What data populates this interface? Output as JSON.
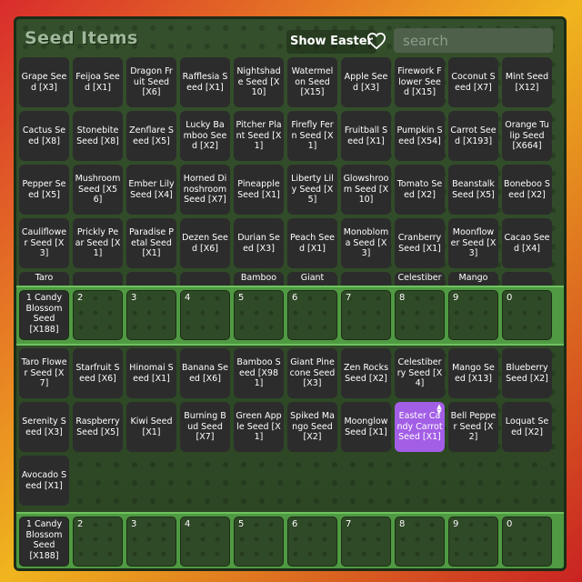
{
  "header": {
    "title": "Seed Items",
    "show_easter_label": "Show Easter",
    "search_placeholder": "search"
  },
  "top_grid": [
    [
      "Grape Seed [X3]",
      "Feijoa Seed [X1]",
      "Dragon Fruit Seed [X6]",
      "Rafflesia Seed [X1]",
      "Nightshade Seed [X10]",
      "Watermelon Seed [X15]",
      "Apple Seed [X3]",
      "Firework Flower Seed [X15]",
      "Coconut Seed [X7]",
      "Mint Seed [X12]"
    ],
    [
      "Cactus Seed [X8]",
      "Stonebite Seed [X8]",
      "Zenflare Seed [X5]",
      "Lucky Bamboo Seed [X2]",
      "Pitcher Plant Seed [X1]",
      "Firefly Fern Seed [X1]",
      "Fruitball Seed [X1]",
      "Pumpkin Seed [X54]",
      "Carrot Seed [X193]",
      "Orange Tulip Seed [X664]"
    ],
    [
      "Pepper Seed [X5]",
      "Mushroom Seed [X56]",
      "Ember Lily Seed [X4]",
      "Horned Dinoshroom Seed [X7]",
      "Pineapple Seed [X1]",
      "Liberty Lily Seed [X5]",
      "Glowshroom Seed [X10]",
      "Tomato Seed [X2]",
      "Beanstalk Seed [X5]",
      "Boneboo Seed [X2]"
    ],
    [
      "Cauliflower Seed [X3]",
      "Prickly Pear Seed [X1]",
      "Paradise Petal Seed [X1]",
      "Dezen Seed [X6]",
      "Durian Seed [X3]",
      "Peach Seed [X1]",
      "Monobloma Seed [X3]",
      "Cranberry Seed [X1]",
      "Moonflower Seed [X3]",
      "Cacao Seed [X4]"
    ],
    [
      "Taro",
      "",
      "",
      "",
      "Bamboo",
      "Giant",
      "",
      "Celestiber",
      "Mango",
      ""
    ]
  ],
  "bottom_grid": [
    [
      "Taro Flower Seed [X7]",
      "Starfruit Seed [X6]",
      "Hinomai Seed [X1]",
      "Banana Seed [X6]",
      "Bamboo Seed [X981]",
      "Giant Pinecone Seed [X3]",
      "Zen Rocks Seed [X2]",
      "Celestiberry Seed [X4]",
      "Mango Seed [X13]",
      "Blueberry Seed [X2]"
    ],
    [
      "Serenity Seed [X3]",
      "Raspberry Seed [X5]",
      "Kiwi Seed [X1]",
      "Burning Bud Seed [X7]",
      "Green Apple Seed [X1]",
      "Spiked Mango Seed [X2]",
      "Moonglow Seed [X1]",
      "Easter Candy Carrot Seed [X1]",
      "Bell Pepper Seed [X2]",
      "Loquat Seed [X2]"
    ],
    [
      "Avocado Seed [X1]",
      "",
      "",
      "",
      "",
      "",
      "",
      "",
      "",
      ""
    ]
  ],
  "hotbar": {
    "first_label": "1 Candy Blossom Seed [X188]",
    "slots": [
      "2",
      "3",
      "4",
      "5",
      "6",
      "7",
      "8",
      "9",
      "0"
    ]
  },
  "colors": {
    "selected": "#a35ee6",
    "hotbar_green": "#4f9a42",
    "cell_dark": "#2c2c2c"
  },
  "icons": [
    "heart-outline-icon",
    "scroll-arrows-icon"
  ]
}
